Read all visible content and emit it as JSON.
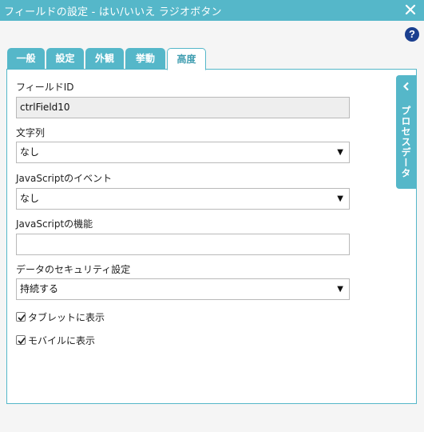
{
  "window": {
    "title": "フィールドの設定 - はい/いいえ ラジオボタン",
    "close_icon": "close-icon",
    "help_label": "?"
  },
  "tabs": [
    {
      "label": "一般",
      "active": false
    },
    {
      "label": "設定",
      "active": false
    },
    {
      "label": "外観",
      "active": false
    },
    {
      "label": "挙動",
      "active": false
    },
    {
      "label": "高度",
      "active": true
    }
  ],
  "form": {
    "field_id": {
      "label": "フィールドID",
      "value": "ctrlField10"
    },
    "string": {
      "label": "文字列",
      "value": "なし"
    },
    "js_event": {
      "label": "JavaScriptのイベント",
      "value": "なし"
    },
    "js_function": {
      "label": "JavaScriptの機能",
      "value": ""
    },
    "data_security": {
      "label": "データのセキュリティ設定",
      "value": "持続する"
    },
    "show_tablet": {
      "label": "タブレットに表示",
      "checked": true
    },
    "show_mobile": {
      "label": "モバイルに表示",
      "checked": true
    }
  },
  "side_panel": {
    "label": "プロセスデータ",
    "chevron_icon": "chevron-left-icon"
  },
  "colors": {
    "accent": "#55b7c9",
    "help_icon": "#1b3f8f"
  }
}
